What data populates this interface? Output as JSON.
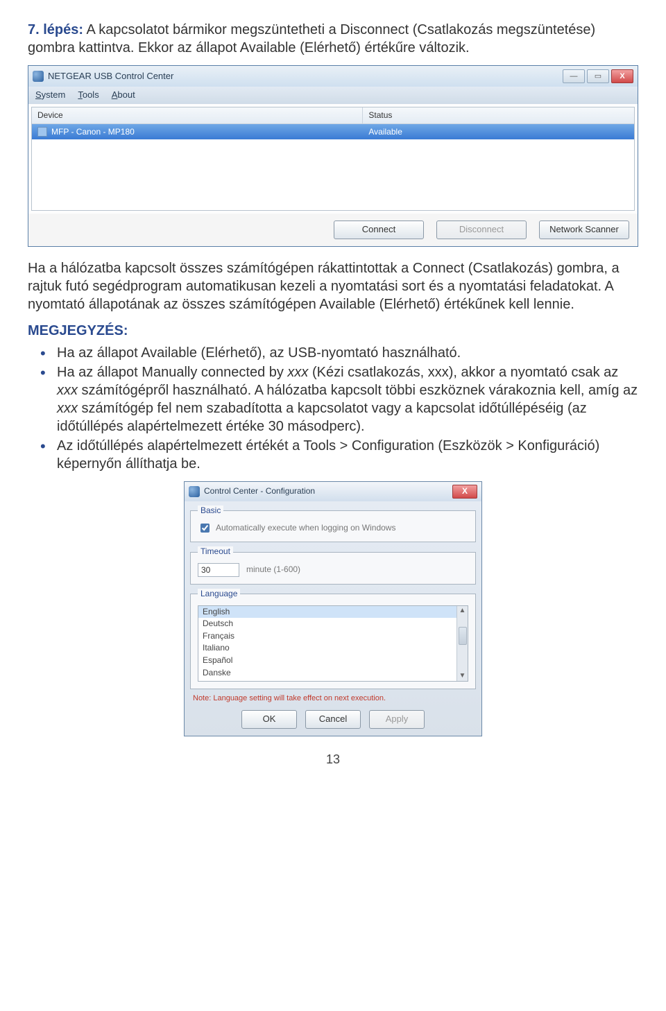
{
  "doc": {
    "step_label": "7. lépés:",
    "step_text_1": " A kapcsolatot bármikor megszüntetheti a Disconnect (Csatlakozás megszüntetése) gombra kattintva. Ekkor az állapot Available (Elérhető) értékűre változik.",
    "para2": "Ha a hálózatba kapcsolt összes számítógépen rákattintottak a Connect (Csatlakozás) gombra, a rajtuk futó segédprogram automatikusan kezeli a nyomtatási sort és a nyomtatási feladatokat. A nyomtató állapotának az összes számítógépen Available (Elérhető) értékűnek kell lennie.",
    "note_label": "MEGJEGYZÉS:",
    "bullets": {
      "b1": "Ha az állapot Available (Elérhető), az USB-nyomtató használható.",
      "b2_a": "Ha az állapot Manually connected by ",
      "b2_xxx1": "xxx",
      "b2_b": " (Kézi csatlakozás, xxx), akkor a nyomtató csak az ",
      "b2_xxx2": "xxx",
      "b2_c": " számítógépről használható. A hálózatba kapcsolt többi eszköznek várakoznia kell, amíg az ",
      "b2_xxx3": "xxx",
      "b2_d": " számítógép fel nem szabadította a kapcsolatot vagy a kapcsolat időtúllépéséig (az időtúllépés alapértelmezett értéke 30 másodperc).",
      "b3": "Az időtúllépés alapértelmezett értékét a Tools > Configuration (Eszközök > Konfiguráció) képernyőn állíthatja be."
    },
    "page": "13"
  },
  "win1": {
    "title": "NETGEAR USB Control Center",
    "menu": {
      "system": "System",
      "tools": "Tools",
      "about": "About"
    },
    "cols": {
      "device": "Device",
      "status": "Status"
    },
    "row": {
      "device": "MFP - Canon - MP180",
      "status": "Available"
    },
    "btns": {
      "connect": "Connect",
      "disconnect": "Disconnect",
      "scanner": "Network Scanner"
    }
  },
  "cfg": {
    "title": "Control Center - Configuration",
    "group_basic": "Basic",
    "chk_label": "Automatically execute when logging on Windows",
    "group_timeout": "Timeout",
    "timeout_value": "30",
    "timeout_unit": "minute (1-600)",
    "group_lang": "Language",
    "langs": {
      "l0": "English",
      "l1": "Deutsch",
      "l2": "Français",
      "l3": "Italiano",
      "l4": "Español",
      "l5": "Danske"
    },
    "note": "Note: Language setting will take effect on next execution.",
    "btn_ok": "OK",
    "btn_cancel": "Cancel",
    "btn_apply": "Apply"
  }
}
